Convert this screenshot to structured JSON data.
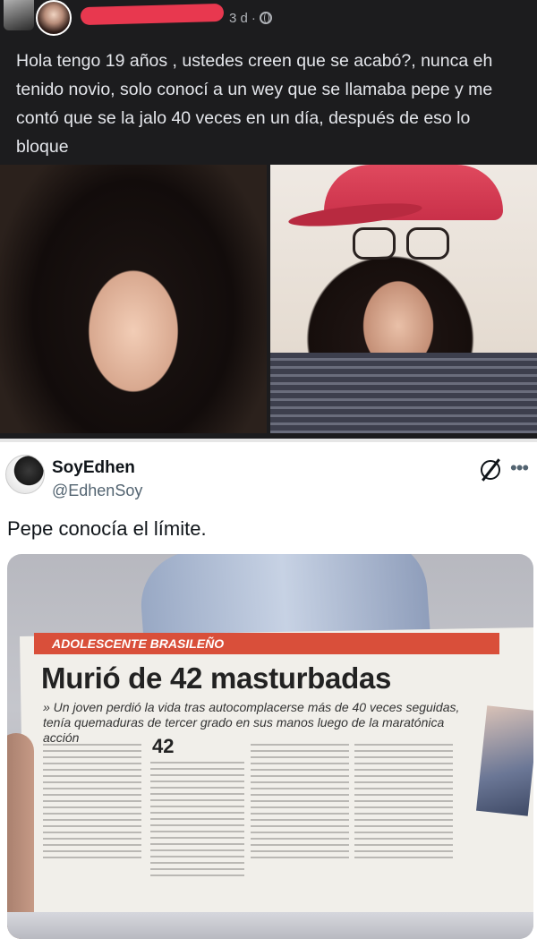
{
  "facebook_post": {
    "time": "3 d",
    "visibility_icon": "globe-icon",
    "text": "Hola tengo 19 años , ustedes creen que se acabó?, nunca eh tenido novio, solo conocí a un wey que se llamaba pepe y me contó que se la jalo 40 veces en un día, después de eso lo bloque"
  },
  "tweet": {
    "display_name": "SoyEdhen",
    "handle": "@EdhenSoy",
    "text": "Pepe conocía el límite.",
    "grok_icon": "grok-icon",
    "more_icon": "more-icon"
  },
  "newspaper": {
    "kicker": "ADOLESCENTE BRASILEÑO",
    "headline": "Murió de 42 masturbadas",
    "deck": "» Un joven perdió la vida tras autocomplacerse más de 40 veces seguidas, tenía quemaduras de tercer grado en sus manos luego de la maratónica acción",
    "big_number": "42"
  },
  "colors": {
    "fb_background": "#1c1c1e",
    "fb_text": "#e4e6eb",
    "redaction": "#e8384f",
    "tweet_text": "#0f1419",
    "tweet_secondary": "#536471",
    "newspaper_accent": "#d94f3a"
  }
}
